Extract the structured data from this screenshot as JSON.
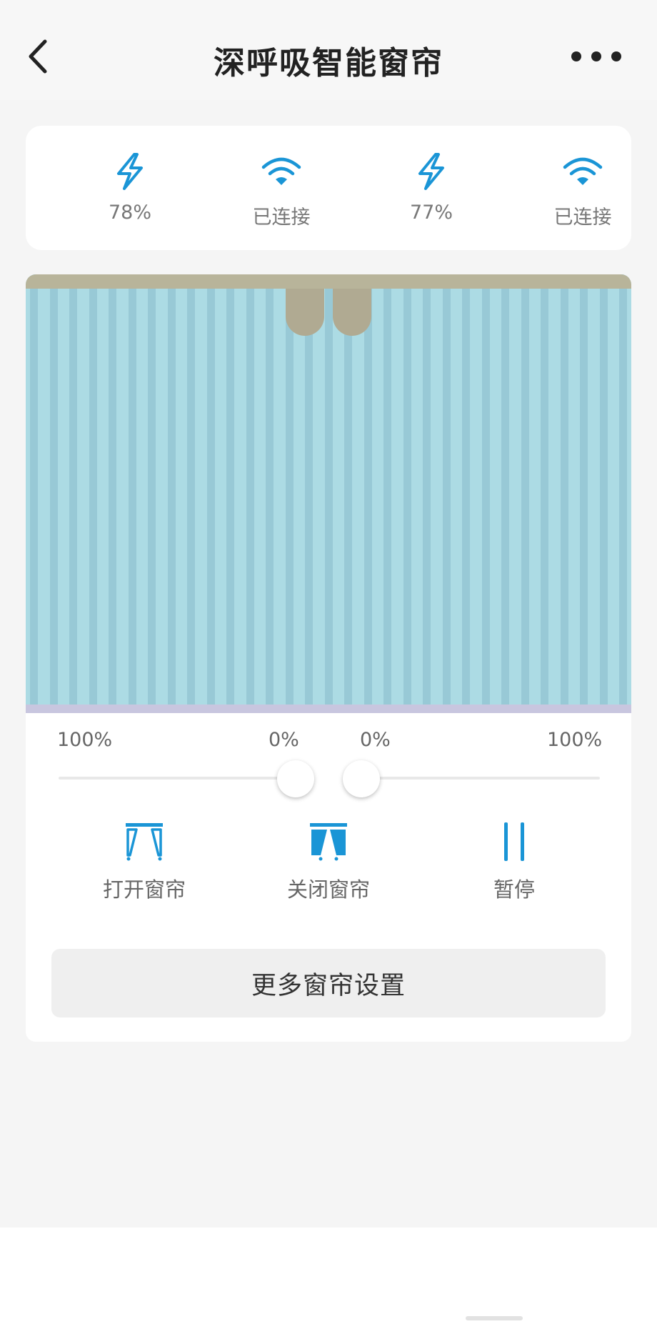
{
  "header": {
    "title": "深呼吸智能窗帘",
    "back_icon": "chevron-left-icon",
    "more_icon": "more-horizontal-icon"
  },
  "status": {
    "items": [
      {
        "icon": "lightning-icon",
        "label": "78%"
      },
      {
        "icon": "wifi-icon",
        "label": "已连接"
      },
      {
        "icon": "lightning-icon",
        "label": "77%"
      },
      {
        "icon": "wifi-icon",
        "label": "已连接"
      }
    ],
    "accent_color": "#1a95d6"
  },
  "curtain": {
    "left_open_label": "100%",
    "left_current_label": "0%",
    "right_current_label": "0%",
    "right_open_label": "100%",
    "left_position": 0,
    "right_position": 0,
    "fabric_color": "#acdbe4"
  },
  "controls": {
    "open_label": "打开窗帘",
    "close_label": "关闭窗帘",
    "pause_label": "暂停"
  },
  "more_settings_label": "更多窗帘设置"
}
